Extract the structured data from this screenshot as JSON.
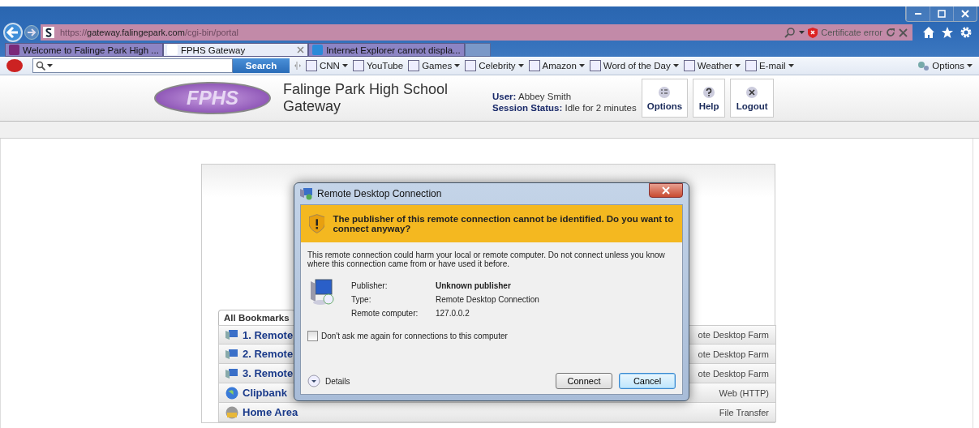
{
  "browser": {
    "url": {
      "scheme": "https://",
      "host": "gateway.falingepark.com",
      "path": "/cgi-bin/portal"
    },
    "address_status": "Certificate error",
    "tabs": [
      {
        "label": "Welcome to Falinge Park High ...",
        "selected": false
      },
      {
        "label": "FPHS Gateway",
        "selected": true
      },
      {
        "label": "Internet Explorer cannot displa...",
        "selected": false
      }
    ],
    "toolbar": {
      "search_button": "Search",
      "options": "Options",
      "favorites": [
        {
          "label": "CNN",
          "dropdown": true
        },
        {
          "label": "YouTube",
          "dropdown": false
        },
        {
          "label": "Games",
          "dropdown": true
        },
        {
          "label": "Celebrity",
          "dropdown": true
        },
        {
          "label": "Amazon",
          "dropdown": true
        },
        {
          "label": "Word of the Day",
          "dropdown": true
        },
        {
          "label": "Weather",
          "dropdown": true
        },
        {
          "label": "E-mail",
          "dropdown": true
        }
      ]
    }
  },
  "page": {
    "logo": "FPHS",
    "title": "Falinge Park High School",
    "subtitle": "Gateway",
    "user_label": "User:",
    "user": "Abbey Smith",
    "session_label": "Session Status:",
    "session": "Idle for 2 minutes",
    "actions": [
      {
        "label": "Options",
        "kind": "options"
      },
      {
        "label": "Help",
        "kind": "help"
      },
      {
        "label": "Logout",
        "kind": "logout"
      }
    ],
    "bookmarks": {
      "tab": "All Bookmarks",
      "rows": [
        {
          "name": "1. Remote",
          "type": "ote Desktop Farm",
          "kind": "remote"
        },
        {
          "name": "2. Remote",
          "type": "ote Desktop Farm",
          "kind": "remote"
        },
        {
          "name": "3. Remote",
          "type": "ote Desktop Farm",
          "kind": "remote"
        },
        {
          "name": "Clipbank",
          "type": "Web (HTTP)",
          "kind": "web"
        },
        {
          "name": "Home Area",
          "type": "File Transfer",
          "kind": "file"
        }
      ]
    }
  },
  "dialog": {
    "title": "Remote Desktop Connection",
    "warning": "The publisher of this remote connection cannot be identified. Do you want to connect anyway?",
    "message": "This remote connection could harm your local or remote computer. Do not connect unless you know where this connection came from or have used it before.",
    "fields": [
      {
        "label": "Publisher:",
        "value": "Unknown publisher",
        "emphasis": true
      },
      {
        "label": "Type:",
        "value": "Remote Desktop Connection",
        "emphasis": false
      },
      {
        "label": "Remote computer:",
        "value": "127.0.0.2",
        "emphasis": false
      }
    ],
    "checkbox": {
      "label": "Don't ask me again for connections to this computer",
      "checked": false
    },
    "details": "Details",
    "buttons": [
      {
        "label": "Connect",
        "default": false
      },
      {
        "label": "Cancel",
        "default": true
      }
    ]
  }
}
